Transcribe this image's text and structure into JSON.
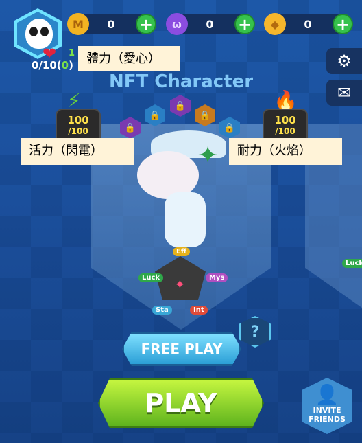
{
  "hud": {
    "lives_text": "0/10(",
    "lives_extra": "0",
    "lives_close": ")",
    "level_prefix": "1",
    "currencies": [
      {
        "icon": "gold-coin-icon",
        "symbol": "M",
        "value": "0",
        "color": "#f2b322"
      },
      {
        "icon": "purple-token-icon",
        "symbol": "ω",
        "value": "0",
        "color": "#8b4de0"
      },
      {
        "icon": "diamond-token-icon",
        "symbol": "◆",
        "value": "0",
        "color": "#f6b62c"
      }
    ],
    "plus_label": "+"
  },
  "title": "NFT Character",
  "callouts": {
    "hp": "體力（愛心）",
    "energy": "活力（閃電）",
    "durability": "耐力（火焰）"
  },
  "stats": {
    "energy": {
      "value": "100",
      "max": "/100",
      "color": "#6bd13c"
    },
    "durability": {
      "value": "100",
      "max": "/100",
      "color": "#6bd13c"
    }
  },
  "attributes": {
    "eff": "Eff",
    "luck": "Luck",
    "mys": "Mys",
    "sta": "Sta",
    "int": "Int"
  },
  "side_attributes": {
    "luck": "Luck"
  },
  "help_label": "?",
  "buttons": {
    "free_play": "FREE PLAY",
    "play": "PLAY",
    "invite_line1": "INVITE",
    "invite_line2": "FRIENDS"
  }
}
